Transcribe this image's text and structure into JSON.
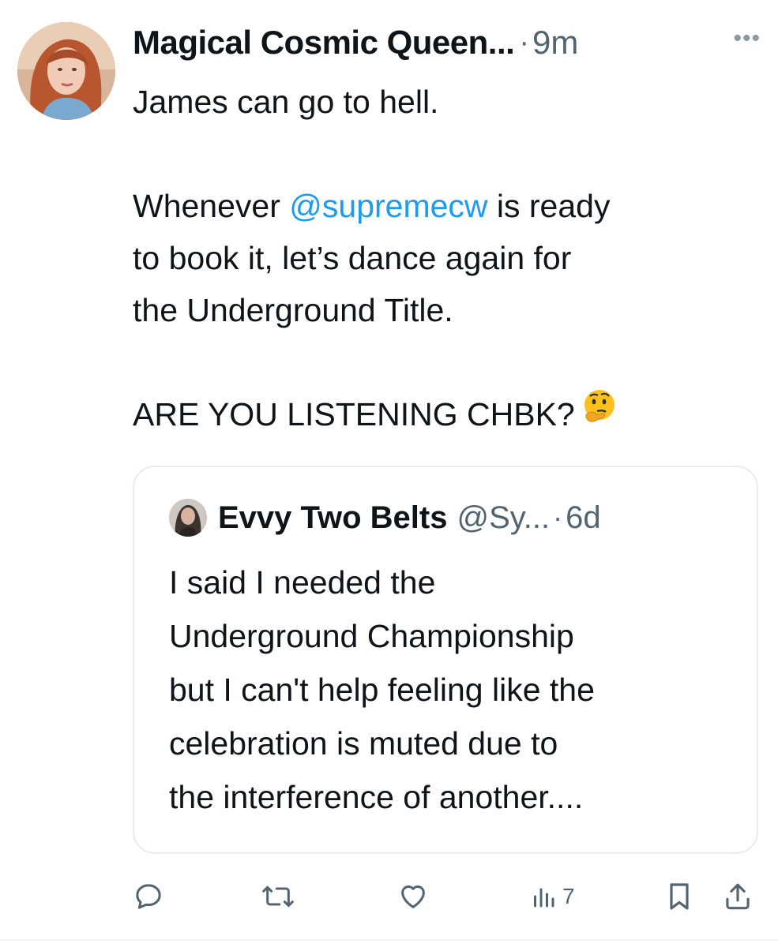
{
  "tweet": {
    "author_name": "Magical Cosmic Queen...",
    "separator": "·",
    "time": "9m",
    "more_label": "•••",
    "text_line1": "James can go to hell.",
    "text_p2_before": "Whenever ",
    "mention": "@supremecw",
    "text_p2_line1_after": " is ready",
    "text_p2_line2": "to book it, let’s dance again for",
    "text_p2_line3": "the Underground Title.",
    "text_p3": "ARE YOU LISTENING CHBK?",
    "emoji_icon": "thinking-face-emoji"
  },
  "quote": {
    "author_name": "Evvy Two Belts",
    "handle": "@Sy...",
    "separator": "·",
    "time": "6d",
    "lines": [
      "I said I needed the",
      "Underground Championship",
      "but I can't help feeling like the",
      "celebration is muted due to",
      "the interference of another...."
    ]
  },
  "actions": {
    "reply_icon": "reply-icon",
    "retweet_icon": "retweet-icon",
    "like_icon": "heart-icon",
    "views_icon": "views-icon",
    "views_count": "7",
    "bookmark_icon": "bookmark-icon",
    "share_icon": "share-icon"
  },
  "colors": {
    "text": "#0f1419",
    "secondary": "#536471",
    "link": "#1d9bf0",
    "border": "#e6ebef"
  }
}
